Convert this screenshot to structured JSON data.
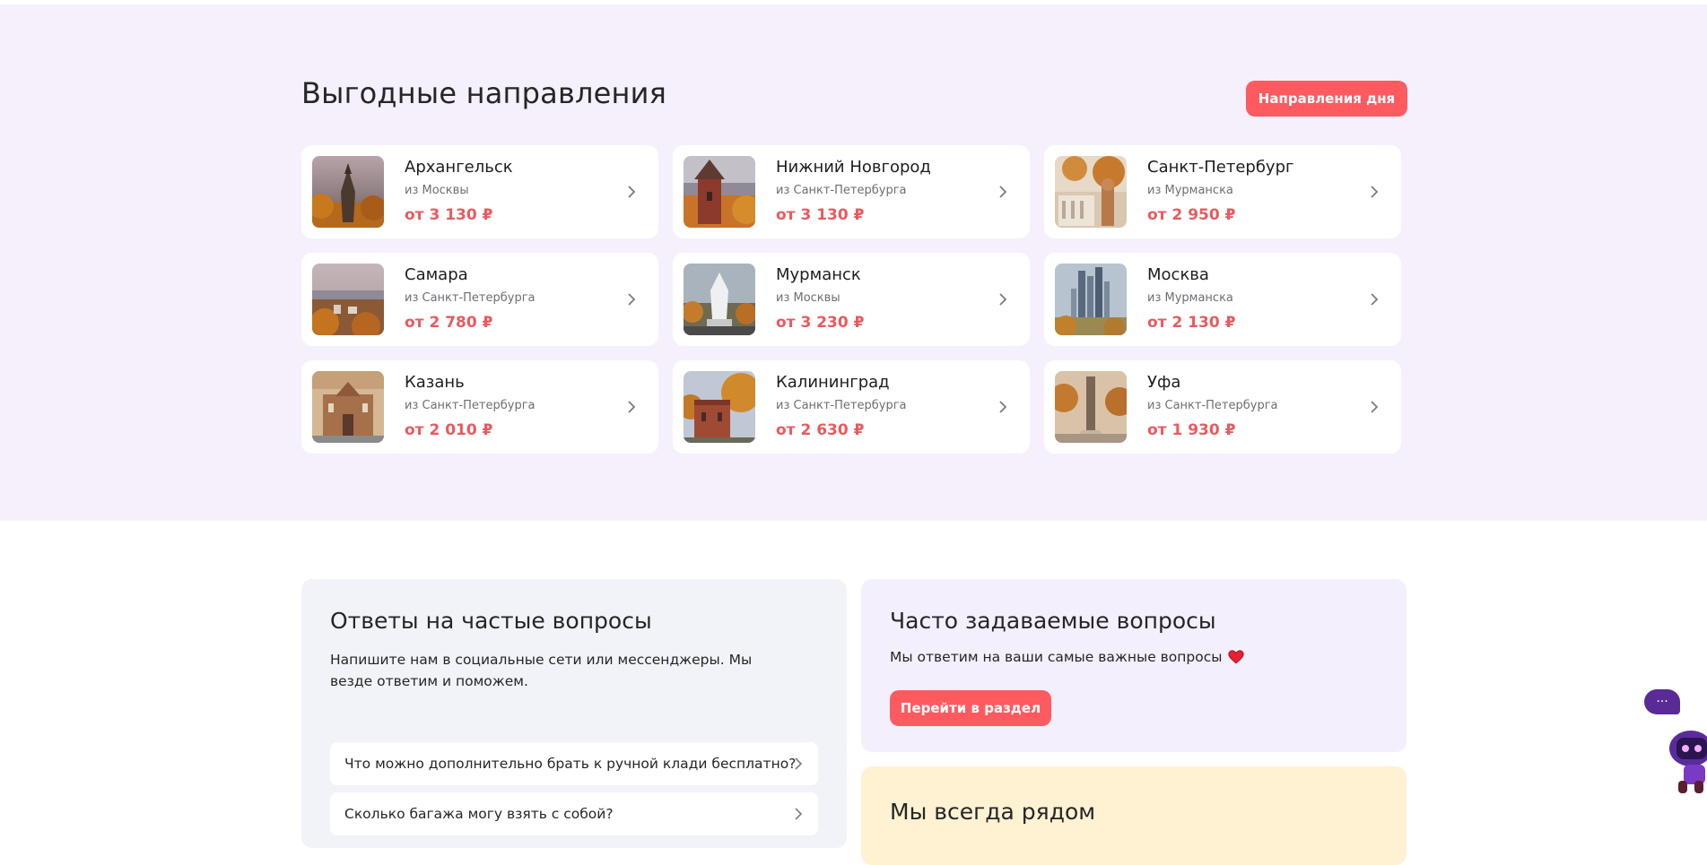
{
  "destinations": {
    "title": "Выгодные направления",
    "day_button": "Направления дня",
    "items": [
      {
        "city": "Архангельск",
        "from": "из Москвы",
        "price": "от 3 130 ₽"
      },
      {
        "city": "Нижний Новгород",
        "from": "из Санкт-Петербурга",
        "price": "от 3 130 ₽"
      },
      {
        "city": "Санкт-Петербург",
        "from": "из Мурманска",
        "price": "от 2 950 ₽"
      },
      {
        "city": "Самара",
        "from": "из Санкт-Петербурга",
        "price": "от 2 780 ₽"
      },
      {
        "city": "Мурманск",
        "from": "из Москвы",
        "price": "от 3 230 ₽"
      },
      {
        "city": "Москва",
        "from": "из Мурманска",
        "price": "от 2 130 ₽"
      },
      {
        "city": "Казань",
        "from": "из Санкт-Петербурга",
        "price": "от 2 010 ₽"
      },
      {
        "city": "Калининград",
        "from": "из Санкт-Петербурга",
        "price": "от 2 630 ₽"
      },
      {
        "city": "Уфа",
        "from": "из Санкт-Петербурга",
        "price": "от 1 930 ₽"
      }
    ]
  },
  "faq_answers": {
    "title": "Ответы на частые вопросы",
    "description": "Напишите нам в социальные сети или мессенджеры. Мы везде ответим и поможем.",
    "questions": [
      "Что можно дополнительно брать к ручной клади бесплатно?",
      "Сколько багажа могу взять с собой?"
    ]
  },
  "faq_section": {
    "title": "Часто задаваемые вопросы",
    "description": "Мы ответим на ваши самые важные вопросы",
    "button": "Перейти в раздел"
  },
  "always_near": {
    "title": "Мы всегда рядом"
  },
  "chat": {
    "label": "···"
  },
  "colors": {
    "accent": "#ff5a60",
    "price": "#e95a5f",
    "section_bg": "#f6f0fd",
    "faq_bg": "#f1f3f9",
    "faq_right_bg": "#f4effd",
    "always_near_bg": "#fff2d3",
    "chat": "#5a2a97"
  }
}
